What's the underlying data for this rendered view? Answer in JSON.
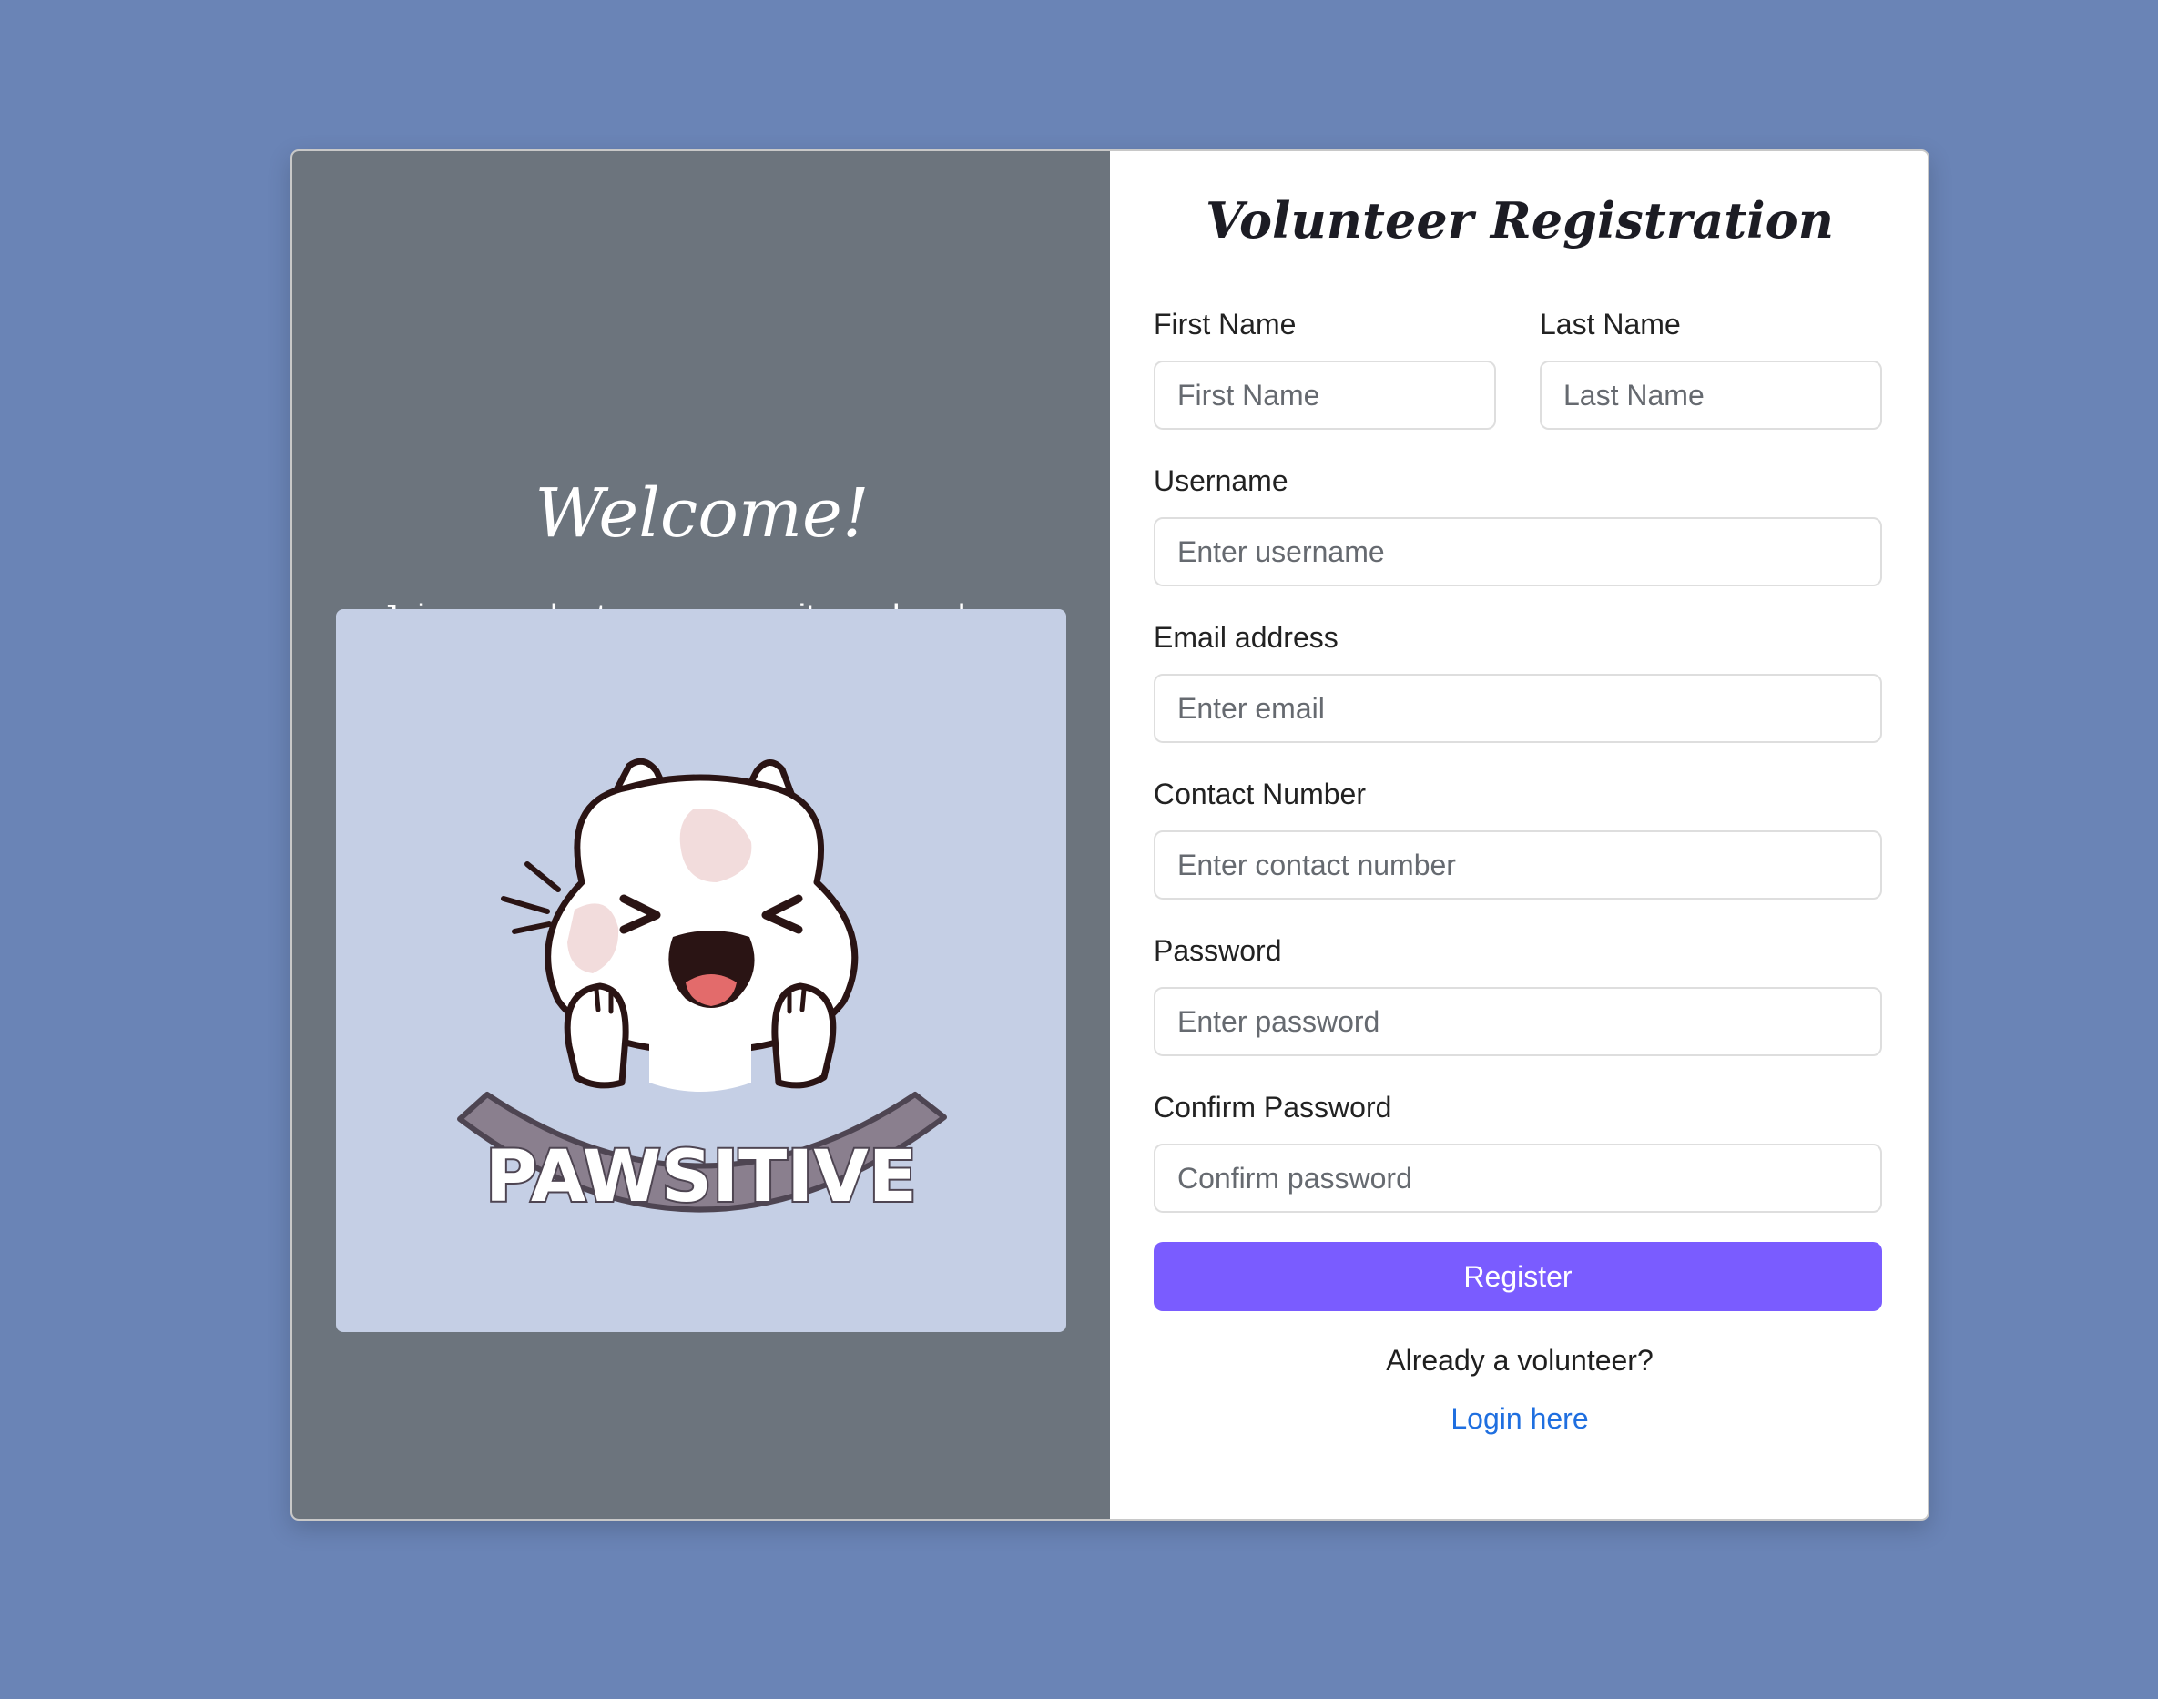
{
  "background_color": "#6a84b6",
  "left_panel": {
    "heading": "Welcome!",
    "tagline": "Join our volunteer community and make a difference.",
    "logo_text": "PAWSITIVE",
    "logo_icon": "cat-mascot-icon"
  },
  "form": {
    "title": "Volunteer Registration",
    "fields": {
      "first_name": {
        "label": "First Name",
        "placeholder": "First Name"
      },
      "last_name": {
        "label": "Last Name",
        "placeholder": "Last Name"
      },
      "username": {
        "label": "Username",
        "placeholder": "Enter username"
      },
      "email": {
        "label": "Email address",
        "placeholder": "Enter email"
      },
      "contact": {
        "label": "Contact Number",
        "placeholder": "Enter contact number"
      },
      "password": {
        "label": "Password",
        "placeholder": "Enter password"
      },
      "confirm_password": {
        "label": "Confirm Password",
        "placeholder": "Confirm password"
      }
    },
    "register_label": "Register",
    "already_text": "Already a volunteer?",
    "login_label": "Login here"
  },
  "colors": {
    "accent": "#7a5cff",
    "link": "#1f6fe0",
    "left_panel": "#6c747d",
    "art_background": "#c5cfe5"
  }
}
